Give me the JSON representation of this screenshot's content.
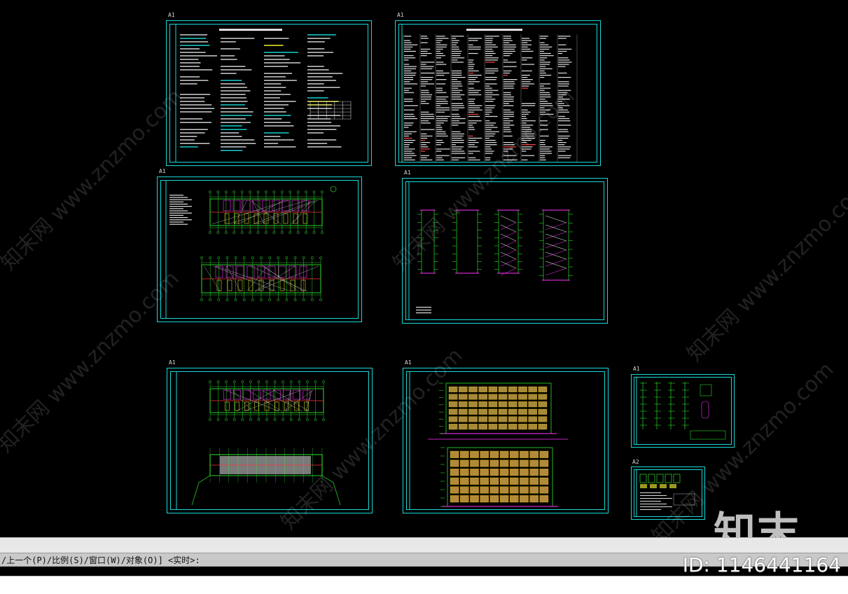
{
  "sheets": [
    {
      "label": "A1",
      "kind": "notes"
    },
    {
      "label": "A1",
      "kind": "table"
    },
    {
      "label": "A1",
      "kind": "plan"
    },
    {
      "label": "A1",
      "kind": "section"
    },
    {
      "label": "A1",
      "kind": "plan2"
    },
    {
      "label": "A1",
      "kind": "elevation"
    },
    {
      "label": "A1",
      "kind": "detail"
    },
    {
      "label": "A2",
      "kind": "legend"
    }
  ],
  "watermark": {
    "text": "知末网 www.znzmo.com"
  },
  "logo": {
    "text": "知末"
  },
  "id_tag": {
    "text": "ID: 1146441164"
  },
  "command": {
    "prompt": "/上一个(P)/比例(S)/窗口(W)/对象(O)] <实时>:"
  },
  "colors": {
    "frame": "#18d9d9",
    "canvas": "#000000",
    "green": "#33ff33",
    "magenta": "#ff33ff",
    "yellow": "#ffff33"
  }
}
